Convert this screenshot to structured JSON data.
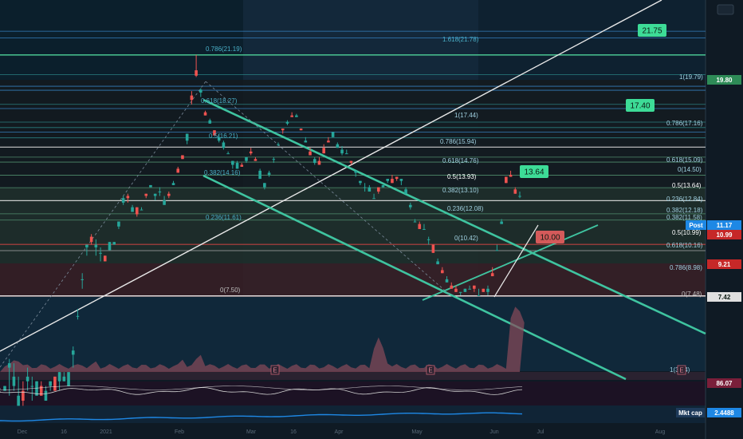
{
  "chart_data": {
    "type": "candlestick",
    "y_axis_scale": "log",
    "ylim": [
      7.0,
      25.0
    ],
    "x_tick_labels": [
      "Dec",
      "16",
      "2021",
      "Feb",
      "Mar",
      "16",
      "Apr",
      "May",
      "Jun",
      "Jul",
      "Aug"
    ],
    "y_tick_labels": [
      "19.80",
      "11.17",
      "10.99",
      "9.21",
      "7.42",
      "86.07",
      "2.4488"
    ],
    "callouts": [
      {
        "label": "21.75",
        "value": 21.75
      },
      {
        "label": "17.40",
        "value": 17.4
      },
      {
        "label": "13.64",
        "value": 13.64
      },
      {
        "label": "10.00",
        "value": 10.0
      }
    ],
    "fib_labels_upper": [
      {
        "label": "0.786(21.19)",
        "value": 21.19
      },
      {
        "label": "1.618(21.78)",
        "value": 21.78
      },
      {
        "label": "0.618(18.27)",
        "value": 18.27
      },
      {
        "label": "0.5(16.21)",
        "value": 16.21
      },
      {
        "label": "0.382(14.16)",
        "value": 14.16
      },
      {
        "label": "0.236(11.61)",
        "value": 11.61
      },
      {
        "label": "0(7.50)",
        "value": 7.5
      }
    ],
    "fib_labels_mid": [
      {
        "label": "1(17.44)",
        "value": 17.44
      },
      {
        "label": "0.786(15.94)",
        "value": 15.94
      },
      {
        "label": "0.618(14.76)",
        "value": 14.76
      },
      {
        "label": "0.5(13.93)",
        "value": 13.93
      },
      {
        "label": "0.382(13.10)",
        "value": 13.1
      },
      {
        "label": "0.236(12.08)",
        "value": 12.08
      },
      {
        "label": "0(10.42)",
        "value": 10.42
      }
    ],
    "fib_labels_right": [
      {
        "label": "1(19.79)",
        "value": 19.79
      },
      {
        "label": "0.786(17.16)",
        "value": 17.16
      },
      {
        "label": "0.618(15.09)",
        "value": 15.09
      },
      {
        "label": "0(14.50)",
        "value": 14.5
      },
      {
        "label": "0.5(13.64)",
        "value": 13.64
      },
      {
        "label": "0.236(12.84)",
        "value": 12.84
      },
      {
        "label": "0.382(12.18)",
        "value": 12.18
      },
      {
        "label": "0.382(11.58)",
        "value": 11.58
      },
      {
        "label": "0.5(10.99)",
        "value": 10.99
      },
      {
        "label": "0.618(10.16)",
        "value": 10.16
      },
      {
        "label": "0.786(8.98)",
        "value": 8.98
      },
      {
        "label": "0(7.48)",
        "value": 7.48
      },
      {
        "label": "1(3.14)",
        "value": 3.14
      }
    ],
    "price_tags": [
      {
        "label": "19.80",
        "color": "#2e8b57"
      },
      {
        "label": "Post",
        "color": "#1e88e5"
      },
      {
        "label": "11.17",
        "color": "#1e88e5"
      },
      {
        "label": "10.99",
        "color": "#c62828"
      },
      {
        "label": "9.21",
        "color": "#c62828"
      },
      {
        "label": "7.42",
        "color": "#e0e0e0"
      }
    ],
    "indicator_tags": [
      {
        "label": "86.07",
        "color": "#7a1f3a"
      },
      {
        "label": "Mkt cap",
        "color": "#1e3a5a"
      },
      {
        "label": "2.4488",
        "color": "#1e88e5"
      }
    ],
    "earnings_markers": [
      "E",
      "E",
      "E"
    ],
    "candles": [
      [
        5.1,
        5.2,
        5.2,
        5.2
      ],
      [
        5.6,
        5.7,
        5.0,
        5.8
      ],
      [
        5.2,
        5.4,
        5.7,
        5.1
      ],
      [
        4.8,
        5.0,
        4.8,
        5.4
      ],
      [
        5.1,
        4.9,
        4.8,
        5.3
      ],
      [
        5.3,
        5.4,
        5.1,
        5.6
      ],
      [
        5.2,
        5.2,
        4.9,
        5.4
      ],
      [
        5.0,
        5.3,
        5.0,
        5.3
      ],
      [
        5.2,
        5.0,
        5.3,
        5.0
      ],
      [
        4.9,
        5.1,
        4.9,
        5.2
      ],
      [
        5.2,
        5.3,
        5.1,
        5.3
      ],
      [
        5.4,
        5.1,
        5.1,
        5.3
      ],
      [
        5.3,
        5.5,
        5.1,
        5.4
      ],
      [
        5.3,
        5.4,
        5.3,
        5.5
      ],
      [
        5.2,
        5.5,
        5.4,
        5.5
      ],
      [
        5.9,
        6.0,
        5.6,
        6.1
      ],
      [
        6.9,
        6.9,
        6.8,
        7.1
      ],
      [
        8.0,
        8.0,
        7.7,
        8.2
      ],
      [
        9.1,
        9.2,
        8.8,
        9.2
      ],
      [
        9.5,
        9.3,
        9.2,
        9.6
      ],
      [
        9.1,
        9.2,
        8.8,
        9.4
      ],
      [
        8.9,
        8.9,
        8.6,
        9.1
      ],
      [
        8.8,
        8.6,
        8.6,
        8.8
      ],
      [
        9.0,
        9.3,
        9.0,
        9.3
      ],
      [
        9.2,
        9.3,
        9.2,
        9.3
      ],
      [
        9.9,
        10.1,
        9.8,
        10.0
      ],
      [
        10.9,
        11.1,
        10.8,
        11.2
      ],
      [
        11.2,
        11.1,
        10.9,
        11.3
      ],
      [
        10.5,
        10.7,
        10.6,
        10.8
      ],
      [
        10.7,
        10.4,
        10.3,
        10.6
      ],
      [
        10.6,
        10.6,
        10.7,
        10.7
      ],
      [
        11.3,
        11.2,
        11.1,
        11.3
      ],
      [
        11.6,
        11.7,
        11.6,
        11.7
      ],
      [
        11.2,
        11.3,
        11.0,
        11.3
      ],
      [
        11.4,
        11.4,
        11.2,
        11.6
      ],
      [
        10.8,
        11.0,
        10.8,
        11.2
      ],
      [
        11.3,
        11.2,
        11.4,
        11.1
      ],
      [
        11.7,
        11.8,
        11.7,
        11.9
      ],
      [
        12.5,
        12.3,
        12.4,
        12.6
      ],
      [
        13.2,
        13.0,
        13.2,
        13.1
      ],
      [
        14.0,
        14.4,
        13.8,
        14.4
      ],
      [
        16.8,
        16.5,
        16.2,
        17.1
      ],
      [
        18.6,
        18.2,
        18.1,
        19.8
      ],
      [
        17.0,
        17.2,
        16.7,
        17.3
      ],
      [
        15.7,
        15.5,
        15.5,
        15.8
      ],
      [
        15.0,
        15.2,
        15.0,
        15.3
      ],
      [
        14.6,
        14.3,
        14.4,
        14.6
      ],
      [
        14.0,
        14.2,
        13.9,
        14.4
      ],
      [
        13.6,
        13.9,
        13.5,
        14.0
      ],
      [
        13.3,
        13.3,
        13.4,
        13.4
      ],
      [
        12.7,
        12.9,
        12.5,
        12.9
      ],
      [
        12.5,
        12.8,
        12.5,
        12.9
      ],
      [
        12.7,
        12.6,
        12.6,
        12.8
      ],
      [
        12.9,
        13.1,
        12.8,
        13.1
      ],
      [
        13.4,
        13.3,
        13.2,
        13.6
      ],
      [
        13.0,
        12.9,
        13.0,
        13.1
      ],
      [
        12.0,
        12.4,
        12.4,
        12.5
      ],
      [
        11.6,
        11.8,
        11.5,
        11.8
      ],
      [
        12.2,
        12.3,
        12.1,
        12.4
      ],
      [
        13.0,
        13.0,
        12.8,
        13.1
      ],
      [
        13.8,
        13.8,
        13.7,
        13.9
      ],
      [
        14.7,
        14.6,
        14.4,
        14.7
      ],
      [
        15.0,
        15.1,
        14.9,
        15.2
      ],
      [
        15.5,
        15.4,
        15.4,
        15.7
      ],
      [
        15.4,
        15.5,
        15.4,
        15.6
      ],
      [
        14.7,
        14.6,
        14.7,
        14.6
      ],
      [
        13.9,
        14.0,
        14.1,
        14.2
      ],
      [
        13.4,
        13.2,
        13.2,
        13.6
      ],
      [
        12.8,
        13.0,
        12.7,
        13.1
      ],
      [
        12.9,
        12.7,
        13.1,
        12.8
      ],
      [
        13.6,
        13.3,
        13.4,
        13.8
      ],
      [
        14.0,
        13.9,
        14.1,
        14.2
      ],
      [
        14.2,
        14.5,
        14.4,
        14.4
      ],
      [
        13.6,
        13.8,
        13.7,
        13.9
      ],
      [
        13.3,
        13.5,
        13.2,
        13.7
      ],
      [
        13.3,
        13.3,
        13.4,
        13.5
      ],
      [
        12.9,
        12.8,
        12.7,
        12.8
      ],
      [
        12.3,
        12.4,
        12.1,
        12.4
      ],
      [
        11.8,
        11.9,
        11.7,
        11.9
      ],
      [
        11.6,
        11.6,
        11.4,
        11.8
      ],
      [
        11.4,
        11.6,
        11.5,
        11.7
      ],
      [
        11.1,
        11.1,
        11.3,
        11.3
      ],
      [
        11.6,
        11.4,
        11.3,
        11.5
      ],
      [
        11.6,
        11.7,
        11.7,
        11.7
      ],
      [
        11.9,
        12.0,
        11.8,
        12.0
      ],
      [
        12.0,
        11.8,
        12.2,
        12.2
      ],
      [
        12.1,
        12.0,
        11.9,
        12.1
      ],
      [
        11.9,
        12.0,
        11.7,
        11.9
      ],
      [
        11.3,
        11.5,
        11.3,
        11.6
      ],
      [
        10.7,
        10.8,
        10.6,
        10.9
      ],
      [
        10.1,
        10.1,
        10.2,
        10.2
      ],
      [
        10.0,
        9.8,
        9.9,
        10.1
      ],
      [
        9.8,
        9.8,
        9.8,
        10.0
      ],
      [
        9.4,
        9.4,
        9.2,
        9.5
      ],
      [
        9.2,
        8.9,
        9.0,
        9.1
      ],
      [
        8.5,
        8.6,
        8.7,
        8.7
      ],
      [
        8.3,
        8.2,
        8.2,
        8.4
      ],
      [
        7.9,
        8.0,
        8.1,
        8.1
      ],
      [
        7.8,
        7.7,
        7.7,
        7.9
      ],
      [
        7.7,
        7.6,
        7.8,
        7.7
      ],
      [
        7.6,
        7.6,
        7.5,
        7.6
      ],
      [
        7.6,
        7.7,
        7.6,
        7.6
      ],
      [
        7.7,
        7.7,
        7.8,
        7.8
      ],
      [
        7.8,
        7.7,
        7.6,
        7.6
      ],
      [
        7.5,
        7.5,
        7.6,
        7.7
      ],
      [
        7.7,
        7.6,
        7.6,
        7.7
      ],
      [
        7.6,
        7.7,
        7.5,
        7.8
      ],
      [
        8.2,
        8.1,
        8.4,
        8.2
      ],
      [
        9.0,
        9.0,
        9.1,
        9.2
      ],
      [
        10.0,
        10.1,
        10.0,
        10.2
      ],
      [
        12.1,
        11.8,
        11.8,
        12.1
      ],
      [
        12.2,
        12.1,
        12.4,
        12.2
      ],
      [
        11.5,
        11.3,
        11.4,
        11.6
      ],
      [
        11.2,
        11.2,
        11.1,
        11.4
      ]
    ]
  }
}
